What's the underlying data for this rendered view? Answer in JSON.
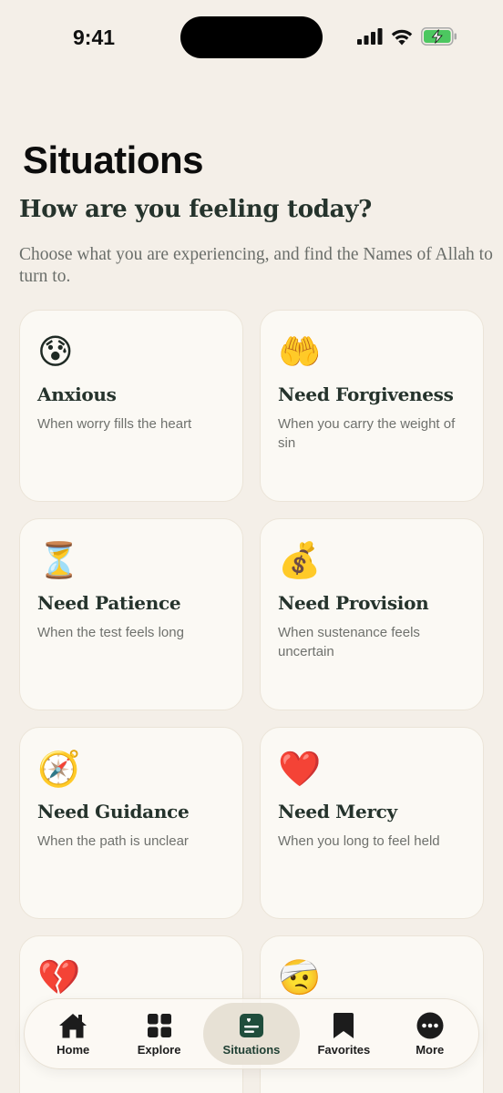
{
  "status_bar": {
    "time": "9:41"
  },
  "header": {
    "title": "Situations",
    "subtitle": "How are you feeling today?",
    "description": "Choose what you are experiencing, and find the Names of Allah to turn to."
  },
  "cards": [
    {
      "emoji": "😰",
      "icon": "anxious-face-icon",
      "title": "Anxious",
      "desc": "When worry fills the heart"
    },
    {
      "emoji": "🤲",
      "icon": "palms-up-icon",
      "title": "Need Forgiveness",
      "desc": "When you carry the weight of sin"
    },
    {
      "emoji": "⏳",
      "icon": "hourglass-icon",
      "title": "Need Patience",
      "desc": "When the test feels long"
    },
    {
      "emoji": "💰",
      "icon": "money-bag-icon",
      "title": "Need Provision",
      "desc": "When sustenance feels uncertain"
    },
    {
      "emoji": "🧭",
      "icon": "compass-icon",
      "title": "Need Guidance",
      "desc": "When the path is unclear"
    },
    {
      "emoji": "❤️",
      "icon": "heart-icon",
      "title": "Need Mercy",
      "desc": "When you long to feel held"
    },
    {
      "emoji": "💔",
      "icon": "broken-heart-icon",
      "title": "",
      "desc": ""
    },
    {
      "emoji": "🤕",
      "icon": "bandaged-face-icon",
      "title": "",
      "desc": ""
    }
  ],
  "tabs": [
    {
      "label": "Home",
      "icon": "house-icon",
      "active": false
    },
    {
      "label": "Explore",
      "icon": "grid-icon",
      "active": false
    },
    {
      "label": "Situations",
      "icon": "situations-icon",
      "active": true
    },
    {
      "label": "Favorites",
      "icon": "bookmark-icon",
      "active": false
    },
    {
      "label": "More",
      "icon": "more-icon",
      "active": false
    }
  ],
  "colors": {
    "background": "#f4efe8",
    "card": "#fbf9f4",
    "accent": "#1f4d3c",
    "text_dark": "#25332c",
    "text_muted": "#6f716d"
  }
}
